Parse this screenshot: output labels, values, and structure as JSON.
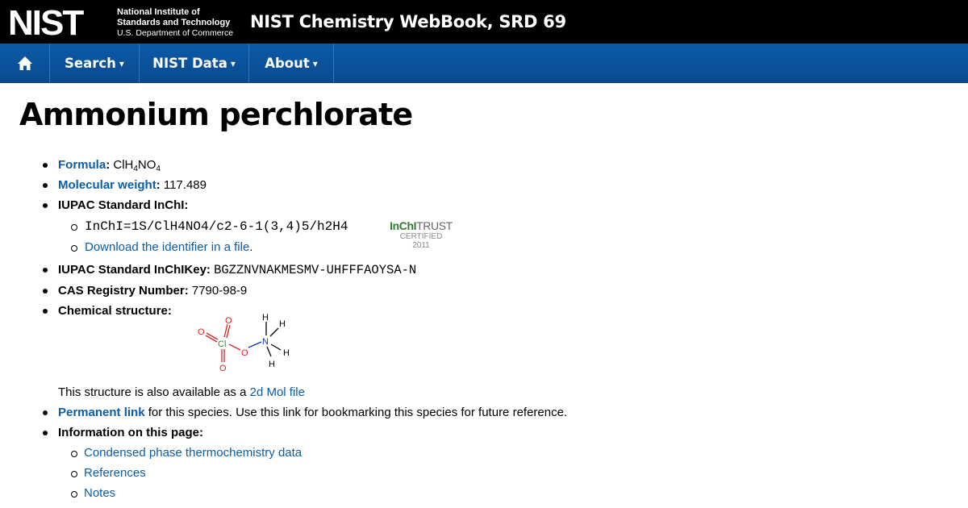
{
  "header": {
    "logo_text": "NIST",
    "institute_line1": "National Institute of",
    "institute_line2": "Standards and Technology",
    "department": "U.S. Department of Commerce",
    "site_title": "NIST Chemistry WebBook, SRD 69"
  },
  "nav": {
    "home_icon": "home-icon",
    "search": "Search",
    "nist_data": "NIST Data",
    "about": "About",
    "caret": "▾"
  },
  "page": {
    "title": "Ammonium perchlorate"
  },
  "compound": {
    "formula_label": "Formula",
    "formula_parts": [
      "ClH",
      "4",
      "NO",
      "4"
    ],
    "mw_label": "Molecular weight",
    "mw_value": "117.489",
    "inchi_label": "IUPAC Standard InChI:",
    "inchi_value": "InChI=1S/ClH4NO4/c2-6-1(3,4)5/h2H4",
    "download_link": "Download the identifier in a file",
    "inchikey_label": "IUPAC Standard InChIKey:",
    "inchikey_value": "BGZZNVNAKMESMV-UHFFFAOYSA-N",
    "cas_label": "CAS Registry Number:",
    "cas_value": "7790-98-9",
    "structure_label": "Chemical structure:",
    "structure_text": "This structure is also available as a",
    "structure_link": "2d Mol file",
    "permalink_link": "Permanent link",
    "permalink_text": "for this species. Use this link for bookmarking this species for future reference.",
    "info_label": "Information on this page:",
    "info_links": [
      "Condensed phase thermochemistry data",
      "References",
      "Notes"
    ]
  },
  "inchi_trust": {
    "brand_bold": "InChI",
    "brand_light": "TRUST",
    "certified": "CERTIFIED",
    "year": "2011"
  },
  "structure_atoms": {
    "o": "O",
    "cl": "Cl",
    "n": "N",
    "h": "H"
  },
  "colors": {
    "link": "#0a5da8",
    "nav_bg": "#0b5aa8",
    "header_bg": "#000000",
    "oxygen": "#e02020",
    "chlorine": "#1ea01e",
    "nitrogen": "#1030c0"
  }
}
